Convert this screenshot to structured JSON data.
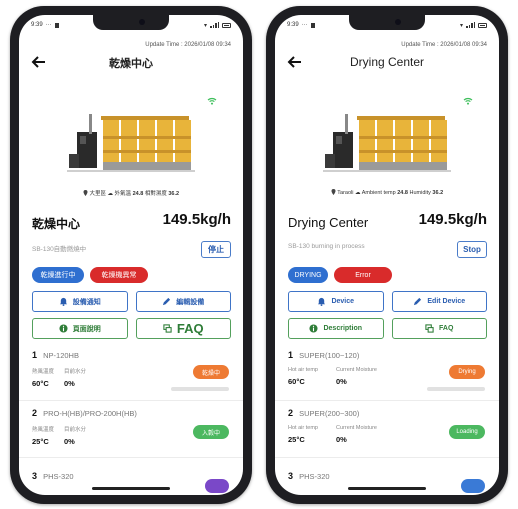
{
  "screens": [
    {
      "status_time": "9:39",
      "update_time": "Update Time : 2026/01/08 09:34",
      "title": "乾燥中心",
      "location": "大里區",
      "ambient_label": "外氣溫",
      "ambient_temp": "24.8",
      "humidity_label": "相對濕度",
      "humidity": "36.2",
      "center_name": "乾燥中心",
      "capacity": "149.5kg/h",
      "sub_status": "SB-130自動燃燒中",
      "stop_label": "停止",
      "badges": [
        "乾燥進行中",
        "乾燥機異常"
      ],
      "actions": [
        "設備通知",
        "編輯設備",
        "頁面說明",
        "FAQ"
      ],
      "dryers": [
        {
          "num": "1",
          "model": "NP-120HB",
          "hot_air_label": "熱風溫度",
          "moisture_label": "目前水分",
          "hot_air": "60°C",
          "moisture": "0%",
          "status": "乾燥中",
          "progress": 0
        },
        {
          "num": "2",
          "model": "PRO-H(HB)/PRO-200H(HB)",
          "hot_air_label": "熱風溫度",
          "moisture_label": "目前水分",
          "hot_air": "25°C",
          "moisture": "0%",
          "status": "入穀中"
        },
        {
          "num": "3",
          "model": "PHS-320"
        }
      ]
    },
    {
      "status_time": "9:39",
      "update_time": "Update Time : 2026/01/08 09:34",
      "title": "Drying Center",
      "location": "Taraoli",
      "ambient_label": "Ambient temp",
      "ambient_temp": "24.8",
      "humidity_label": "Humidity",
      "humidity": "36.2",
      "center_name": "Drying Center",
      "capacity": "149.5kg/h",
      "sub_status": "SB-130 burning in process",
      "stop_label": "Stop",
      "badges": [
        "DRYING",
        "Error"
      ],
      "actions": [
        "Device",
        "Edit Device",
        "Description",
        "FAQ"
      ],
      "dryers": [
        {
          "num": "1",
          "model": "SUPER(100~120)",
          "hot_air_label": "Hot air temp",
          "moisture_label": "Current Moisture",
          "hot_air": "60°C",
          "moisture": "0%",
          "status": "Drying",
          "progress": 0
        },
        {
          "num": "2",
          "model": "SUPER(200~300)",
          "hot_air_label": "Hot air temp",
          "moisture_label": "Current Moisture",
          "hot_air": "25°C",
          "moisture": "0%",
          "status": "Loading"
        },
        {
          "num": "3",
          "model": "PHS-320"
        }
      ]
    }
  ],
  "colors": {
    "primary_blue": "#2f6fd0",
    "error_red": "#d92b2b",
    "action_green": "#54a05c",
    "drying_orange": "#ee7a33",
    "loading_green": "#4cb860",
    "machine_yellow": "#e8b43a"
  },
  "icons": [
    "back-arrow-icon",
    "wifi-icon",
    "location-pin-icon",
    "bell-icon",
    "edit-icon",
    "info-icon",
    "faq-icon",
    "signal-icon",
    "battery-icon"
  ]
}
